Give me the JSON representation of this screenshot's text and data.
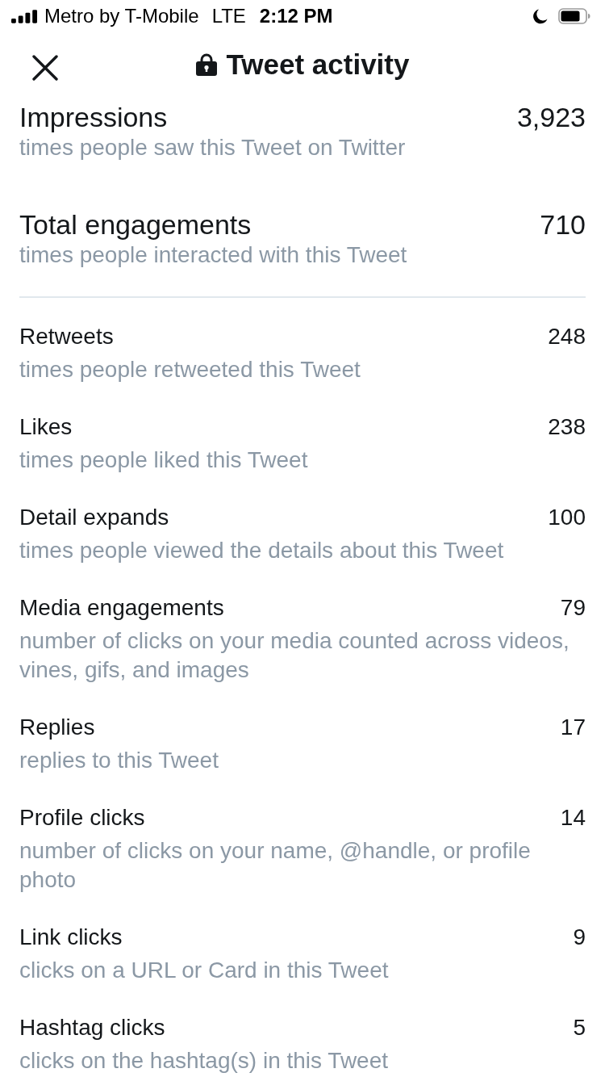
{
  "status_bar": {
    "carrier": "Metro by T-Mobile",
    "network": "LTE",
    "time": "2:12 PM"
  },
  "header": {
    "title": "Tweet activity"
  },
  "summary": [
    {
      "label": "Impressions",
      "value": "3,923",
      "description": "times people saw this Tweet on Twitter"
    },
    {
      "label": "Total engagements",
      "value": "710",
      "description": "times people interacted with this Tweet"
    }
  ],
  "metrics": [
    {
      "label": "Retweets",
      "value": "248",
      "description": "times people retweeted this Tweet"
    },
    {
      "label": "Likes",
      "value": "238",
      "description": "times people liked this Tweet"
    },
    {
      "label": "Detail expands",
      "value": "100",
      "description": "times people viewed the details about this Tweet"
    },
    {
      "label": "Media engagements",
      "value": "79",
      "description": "number of clicks on your media counted across videos, vines, gifs, and images"
    },
    {
      "label": "Replies",
      "value": "17",
      "description": "replies to this Tweet"
    },
    {
      "label": "Profile clicks",
      "value": "14",
      "description": "number of clicks on your name, @handle, or profile photo"
    },
    {
      "label": "Link clicks",
      "value": "9",
      "description": "clicks on a URL or Card in this Tweet"
    },
    {
      "label": "Hashtag clicks",
      "value": "5",
      "description": "clicks on the hashtag(s) in this Tweet"
    }
  ]
}
